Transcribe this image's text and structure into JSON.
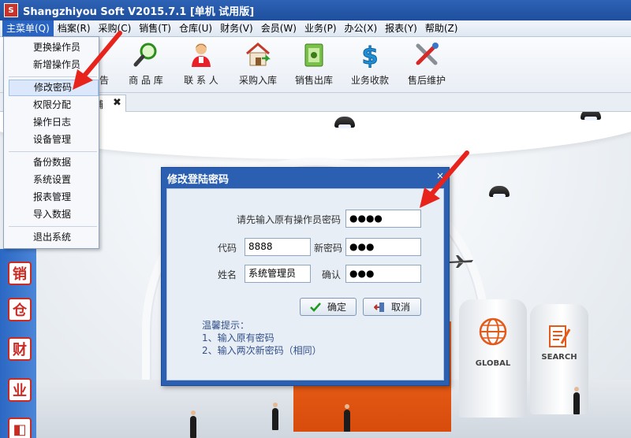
{
  "window": {
    "title": "Shangzhiyou Soft V2015.7.1 [单机 试用版]",
    "app_icon": "app-logo-icon"
  },
  "menubar": {
    "items": [
      "主菜单(Q)",
      "档案(R)",
      "采购(C)",
      "销售(T)",
      "仓库(U)",
      "财务(V)",
      "会员(W)",
      "业务(P)",
      "办公(X)",
      "报表(Y)",
      "帮助(Z)"
    ]
  },
  "toolbar": {
    "partial_label": "告",
    "buttons": [
      {
        "label": "商 品 库",
        "icon": "magnifier-icon"
      },
      {
        "label": "联 系 人",
        "icon": "contact-person-icon"
      },
      {
        "label": "采购入库",
        "icon": "house-inbound-icon"
      },
      {
        "label": "销售出库",
        "icon": "money-outbound-icon"
      },
      {
        "label": "业务收款",
        "icon": "dollar-icon"
      },
      {
        "label": "售后维护",
        "icon": "tools-icon"
      }
    ]
  },
  "tab": {
    "label": "铺",
    "close": "✖"
  },
  "main_menu": {
    "items": [
      "更换操作员",
      "新增操作员",
      "修改密码",
      "权限分配",
      "操作日志",
      "设备管理",
      "备份数据",
      "系统设置",
      "报表管理",
      "导入数据",
      "退出系统"
    ],
    "highlighted": "修改密码"
  },
  "sidenav": {
    "buttons": [
      "销",
      "仓",
      "财",
      "业",
      "◧"
    ]
  },
  "scene": {
    "pillar_left": "GLOBAL",
    "pillar_right": "SEARCH"
  },
  "dialog": {
    "title": "修改登陆密码",
    "close": "×",
    "old_password_label": "请先输入原有操作员密码",
    "old_password_value": "●●●●",
    "code_label": "代码",
    "code_value": "8888",
    "new_password_label": "新密码",
    "new_password_value": "●●●",
    "name_label": "姓名",
    "name_value": "系统管理员",
    "confirm_label": "确认",
    "confirm_value": "●●●",
    "ok_button": "确定",
    "cancel_button": "取消",
    "hint_title": "温馨提示：",
    "hint_1": "1、输入原有密码",
    "hint_2": "2、输入两次新密码（相同）"
  },
  "colors": {
    "accent": "#2a64c2",
    "dialog_title_bar": "#2a5fb1",
    "annotation_arrow": "#e8231c",
    "side_brand": "#c92b22"
  }
}
